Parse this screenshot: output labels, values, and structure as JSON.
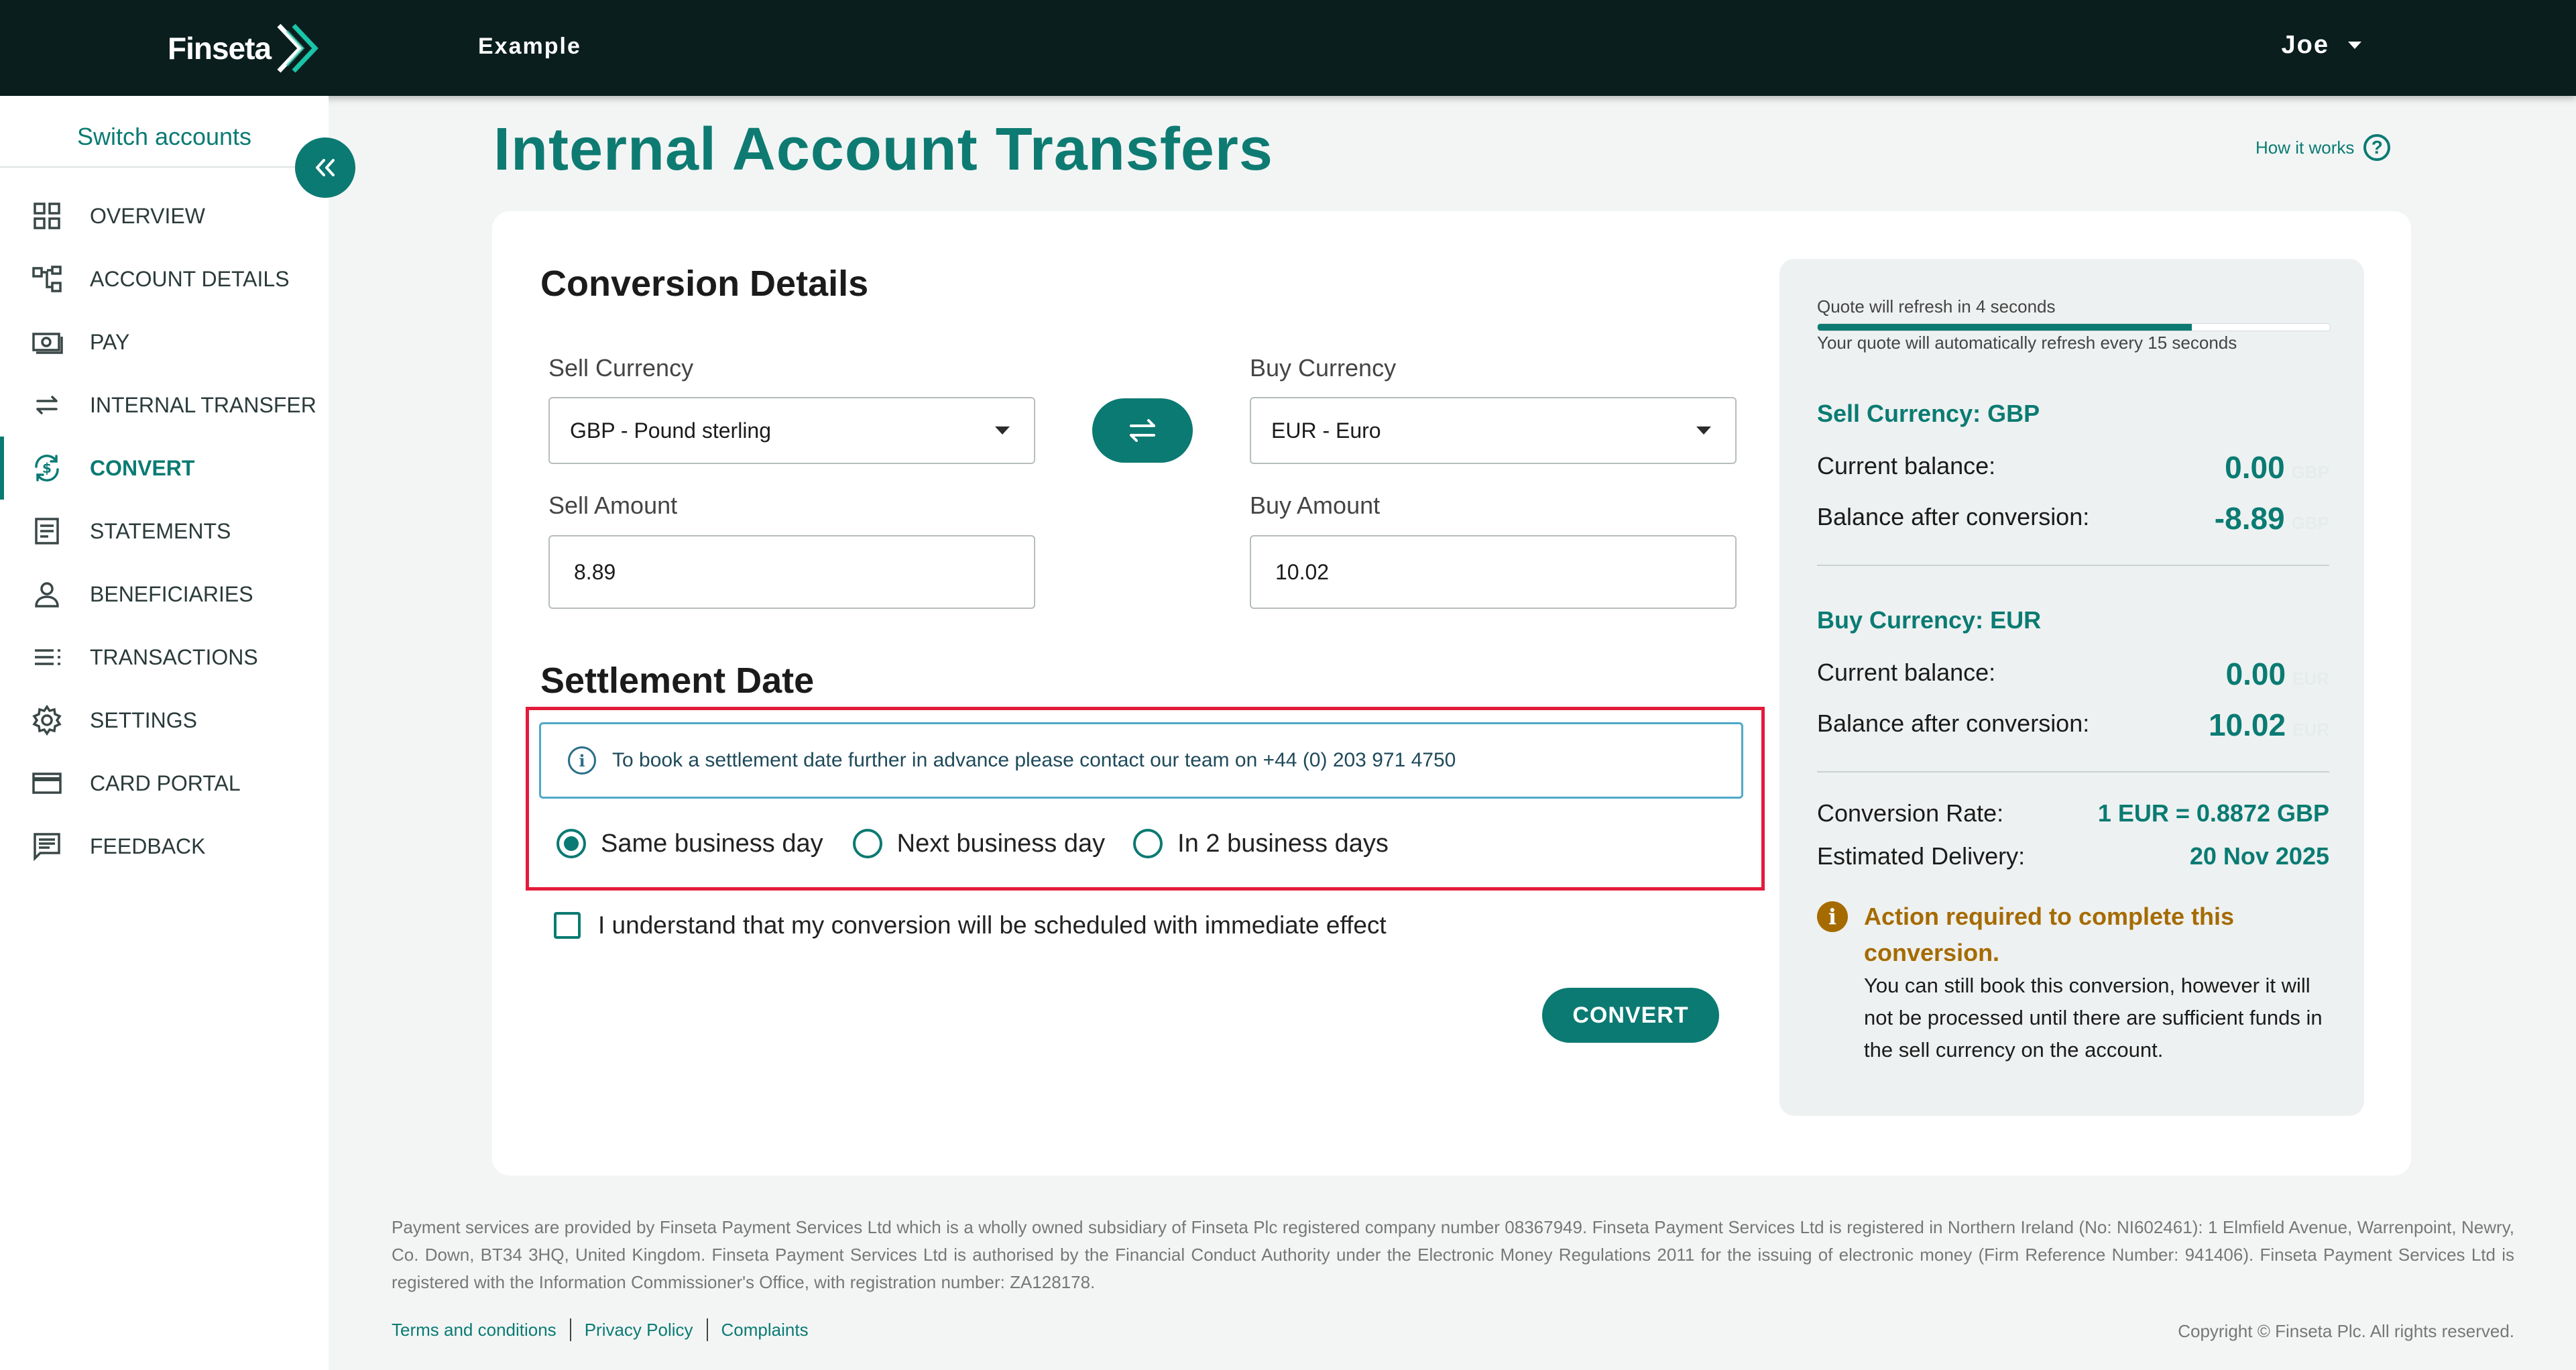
{
  "header": {
    "logo_text": "Finseta",
    "app_name": "Example",
    "user_name": "Joe"
  },
  "sidebar": {
    "switch_accounts": "Switch accounts",
    "items": [
      {
        "label": "OVERVIEW",
        "icon": "grid-icon"
      },
      {
        "label": "ACCOUNT DETAILS",
        "icon": "hierarchy-icon"
      },
      {
        "label": "PAY",
        "icon": "cash-icon"
      },
      {
        "label": "INTERNAL TRANSFER",
        "icon": "transfer-arrows-icon"
      },
      {
        "label": "CONVERT",
        "icon": "currency-convert-icon",
        "active": true
      },
      {
        "label": "STATEMENTS",
        "icon": "document-icon"
      },
      {
        "label": "BENEFICIARIES",
        "icon": "person-icon"
      },
      {
        "label": "TRANSACTIONS",
        "icon": "list-icon"
      },
      {
        "label": "SETTINGS",
        "icon": "gear-icon"
      },
      {
        "label": "CARD PORTAL",
        "icon": "card-icon"
      },
      {
        "label": "FEEDBACK",
        "icon": "chat-icon"
      }
    ]
  },
  "page": {
    "title": "Internal Account Transfers",
    "how_it_works": "How it works"
  },
  "conversion": {
    "title": "Conversion Details",
    "sell_currency_label": "Sell Currency",
    "sell_currency_value": "GBP - Pound sterling",
    "buy_currency_label": "Buy Currency",
    "buy_currency_value": "EUR - Euro",
    "sell_amount_label": "Sell Amount",
    "sell_amount_value": "8.89",
    "buy_amount_label": "Buy Amount",
    "buy_amount_value": "10.02"
  },
  "settlement": {
    "title": "Settlement Date",
    "info": "To book a settlement date further in advance please contact our team on +44 (0) 203 971 4750",
    "options": [
      {
        "label": "Same business day",
        "checked": true
      },
      {
        "label": "Next business day",
        "checked": false
      },
      {
        "label": "In 2 business days",
        "checked": false
      }
    ],
    "checkbox_label": "I understand that my conversion will be scheduled with immediate effect",
    "convert_button": "CONVERT"
  },
  "quote": {
    "refresh_text": "Quote will refresh in 4 seconds",
    "refresh_progress": 0.73,
    "auto_refresh_text": "Your quote will automatically refresh every 15 seconds",
    "sell_heading": "Sell Currency: GBP",
    "sell_current_label": "Current balance:",
    "sell_current_value": "0.00",
    "sell_current_currency": "GBP",
    "sell_after_label": "Balance after conversion:",
    "sell_after_value": "-8.89",
    "sell_after_currency": "GBP",
    "buy_heading": "Buy Currency: EUR",
    "buy_current_label": "Current balance:",
    "buy_current_value": "0.00",
    "buy_current_currency": "EUR",
    "buy_after_label": "Balance after conversion:",
    "buy_after_value": "10.02",
    "buy_after_currency": "EUR",
    "rate_label": "Conversion Rate:",
    "rate_value": "1 EUR = 0.8872 GBP",
    "delivery_label": "Estimated Delivery:",
    "delivery_value": "20 Nov 2025",
    "warning_title": "Action required to complete this conversion.",
    "warning_body": "You can still book this conversion, however it will not be processed until there are sufficient funds in the sell currency on the account."
  },
  "footer": {
    "text": "Payment services are provided by Finseta Payment Services Ltd which is a wholly owned subsidiary of Finseta Plc registered company number 08367949. Finseta Payment Services Ltd is registered in Northern Ireland (No: NI602461): 1 Elmfield Avenue, Warrenpoint, Newry, Co. Down, BT34 3HQ, United Kingdom. Finseta Payment Services Ltd is authorised by the Financial Conduct Authority under the Electronic Money Regulations 2011 for the issuing of electronic money (Firm Reference Number: 941406). Finseta Payment Services Ltd is registered with the Information Commissioner's Office, with registration number: ZA128178.",
    "links": [
      "Terms and conditions",
      "Privacy Policy",
      "Complaints"
    ],
    "copyright": "Copyright © Finseta Plc. All rights reserved."
  },
  "colors": {
    "brand": "#0b7a72",
    "header_bg": "#0b1e1e",
    "highlight_frame": "#e21b3b",
    "warning": "#a56b00"
  }
}
